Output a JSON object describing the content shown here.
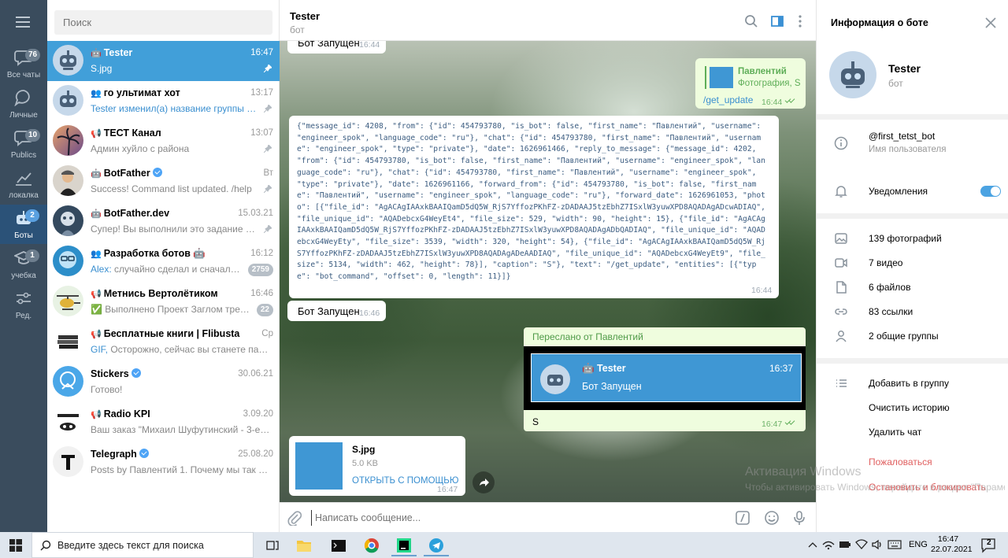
{
  "rail": {
    "items": [
      {
        "label": "Все чаты",
        "badge": "76"
      },
      {
        "label": "Личные",
        "badge": ""
      },
      {
        "label": "Publics",
        "badge": "10"
      },
      {
        "label": "локалка",
        "badge": ""
      },
      {
        "label": "Боты",
        "badge": "2"
      },
      {
        "label": "учебка",
        "badge": "1"
      },
      {
        "label": "Ред.",
        "badge": ""
      }
    ]
  },
  "search": {
    "placeholder": "Поиск"
  },
  "chats": [
    {
      "name": "Tester",
      "time": "16:47",
      "preview": "S.jpg"
    },
    {
      "name": "го ультимат хот",
      "time": "13:17",
      "preview": "Tester изменил(а) название группы на..."
    },
    {
      "name": "ТЕСТ Канал",
      "time": "13:07",
      "preview": "Админ хуйло с района"
    },
    {
      "name": "BotFather",
      "time": "Вт",
      "preview": "Success! Command list updated. /help"
    },
    {
      "name": "BotFather.dev",
      "time": "15.03.21",
      "preview": "Супер! Вы выполнили это задание и п..."
    },
    {
      "name": "Разработка ботов 🤖",
      "time": "16:12",
      "preview_sender": "Alex:",
      "preview": " случайно сделал и сначала не ...",
      "count": "2759"
    },
    {
      "name": "Метнись Вертолётиком",
      "time": "16:46",
      "preview_sender": "✅ Выполнено",
      "preview": " Проект Заглом треб...",
      "count": "22"
    },
    {
      "name": "Бесплатные книги | Flibusta",
      "time": "Ср",
      "preview_sender": "GIF,",
      "preview": " Осторожно, сейчас вы станете парано..."
    },
    {
      "name": "Stickers",
      "time": "30.06.21",
      "preview": "Готово!"
    },
    {
      "name": "Radio KPI",
      "time": "3.09.20",
      "preview": "Ваш заказ \"Михаил Шуфутинский - 3-е сент..."
    },
    {
      "name": "Telegraph",
      "time": "25.08.20",
      "preview": "Posts by Павлентий  1. Почему мы так оди..."
    }
  ],
  "chat": {
    "title": "Tester",
    "subtitle": "бот",
    "msg_top": {
      "text": "Бот Запущен",
      "time": "16:44"
    },
    "reply_msg": {
      "reply_name": "Павлентий",
      "reply_text": "Фотография, S",
      "text": "/get_update",
      "time": "16:44"
    },
    "json_msg": {
      "text": "{\"message_id\": 4208, \"from\": {\"id\": 454793780, \"is_bot\": false, \"first_name\": \"Павлентий\", \"username\": \"engineer_spok\", \"language_code\": \"ru\"}, \"chat\": {\"id\": 454793780, \"first_name\": \"Павлентий\", \"username\": \"engineer_spok\", \"type\": \"private\"}, \"date\": 1626961466, \"reply_to_message\": {\"message_id\": 4202, \"from\": {\"id\": 454793780, \"is_bot\": false, \"first_name\": \"Павлентий\", \"username\": \"engineer_spok\", \"language_code\": \"ru\"}, \"chat\": {\"id\": 454793780, \"first_name\": \"Павлентий\", \"username\": \"engineer_spok\", \"type\": \"private\"}, \"date\": 1626961166, \"forward_from\": {\"id\": 454793780, \"is_bot\": false, \"first_name\": \"Павлентий\", \"username\": \"engineer_spok\", \"language_code\": \"ru\"}, \"forward_date\": 1626961053, \"photo\": [{\"file_id\": \"AgACAgIAAxkBAAIQamD5dQ5W_RjS7YffozPKhFZ-zDADAAJ5tzEbhZ7ISxlW3yuwXPD8AQADAgADcwADIAQ\", \"file_unique_id\": \"AQADebcxG4WeyEt4\", \"file_size\": 529, \"width\": 90, \"height\": 15}, {\"file_id\": \"AgACAgIAAxkBAAIQamD5dQ5W_RjS7YffozPKhFZ-zDADAAJ5tzEbhZ7ISxlW3yuwXPD8AQADAgADbQADIAQ\", \"file_unique_id\": \"AQADebcxG4WeyEty\", \"file_size\": 3539, \"width\": 320, \"height\": 54}, {\"file_id\": \"AgACAgIAAxkBAAIQamD5dQ5W_RjS7YffozPKhFZ-zDADAAJ5tzEbhZ7ISxlW3yuwXPD8AQADAgADeAADIAQ\", \"file_unique_id\": \"AQADebcxG4WeyEt9\", \"file_size\": 5134, \"width\": 462, \"height\": 78}], \"caption\": \"S\"}, \"text\": \"/get_update\", \"entities\": [{\"type\": \"bot_command\", \"offset\": 0, \"length\": 11}]}",
      "time": "16:44"
    },
    "msg_bot2": {
      "text": "Бот Запущен",
      "time": "16:46"
    },
    "forward_msg": {
      "header": "Переслано от Павлентий",
      "inner_name": "Tester",
      "inner_time": "16:37",
      "inner_text": "Бот Запущен",
      "caption": "S",
      "time": "16:47"
    },
    "file_msg": {
      "filename": "S.jpg",
      "size": "5.0 KB",
      "action": "ОТКРЫТЬ С ПОМОЩЬЮ",
      "time": "16:47"
    },
    "composer_placeholder": "Написать сообщение..."
  },
  "info": {
    "title": "Информация о боте",
    "name": "Tester",
    "subtitle": "бот",
    "username": "@first_tetst_bot",
    "username_label": "Имя пользователя",
    "notifications": "Уведомления",
    "media": [
      {
        "label": "139 фотографий",
        "icon": "photo-icon"
      },
      {
        "label": "7 видео",
        "icon": "video-icon"
      },
      {
        "label": "6 файлов",
        "icon": "file-icon"
      },
      {
        "label": "83 ссылки",
        "icon": "link-icon"
      },
      {
        "label": "2 общие группы",
        "icon": "group-icon"
      }
    ],
    "actions": [
      {
        "label": "Добавить в группу"
      },
      {
        "label": "Очистить историю"
      },
      {
        "label": "Удалить чат"
      },
      {
        "label": "Пожаловаться"
      },
      {
        "label": "Остановить и блокировать"
      }
    ]
  },
  "watermark": {
    "line1": "Активация Windows",
    "line2": "Чтобы активировать Windows, перейдите в раздел \"Параметры\"."
  },
  "taskbar": {
    "search_placeholder": "Введите здесь текст для поиска",
    "lang": "ENG",
    "time": "16:47",
    "date": "22.07.2021",
    "notif_count": "2"
  },
  "colors": {
    "accent": "#419fd9",
    "rail": "#3a4c5d",
    "outgoing": "#effdde",
    "danger": "#e05f5f"
  }
}
